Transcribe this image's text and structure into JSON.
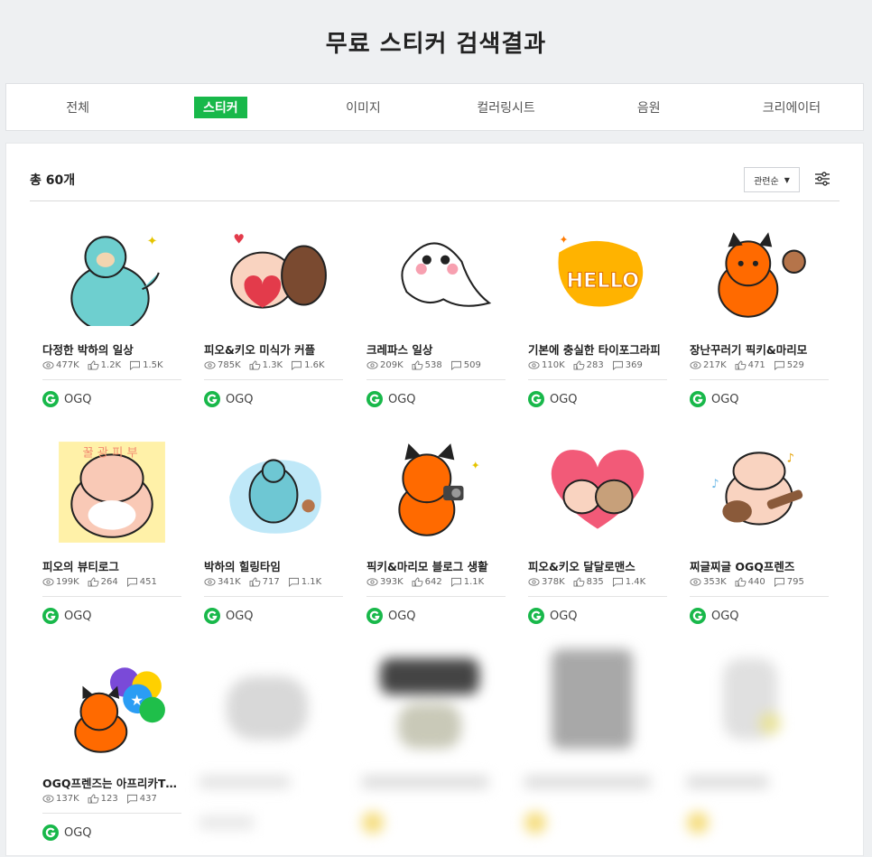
{
  "page": {
    "title": "무료 스티커 검색결과"
  },
  "tabs": [
    {
      "label": "전체",
      "active": false
    },
    {
      "label": "스티커",
      "active": true
    },
    {
      "label": "이미지",
      "active": false
    },
    {
      "label": "컬러링시트",
      "active": false
    },
    {
      "label": "음원",
      "active": false
    },
    {
      "label": "크리에이터",
      "active": false
    }
  ],
  "results": {
    "total_label": "총 60개",
    "sort_label": "관련순"
  },
  "accent_color": "#18b84a",
  "cards": [
    {
      "title": "다정한 박하의 일상",
      "views": "477K",
      "likes": "1.2K",
      "comments": "1.5K",
      "author": "OGQ"
    },
    {
      "title": "피오&키오 미식가 커플",
      "views": "785K",
      "likes": "1.3K",
      "comments": "1.6K",
      "author": "OGQ"
    },
    {
      "title": "크레파스 일상",
      "views": "209K",
      "likes": "538",
      "comments": "509",
      "author": "OGQ"
    },
    {
      "title": "기본에 충실한 타이포그라피",
      "views": "110K",
      "likes": "283",
      "comments": "369",
      "author": "OGQ"
    },
    {
      "title": "장난꾸러기 픽키&마리모",
      "views": "217K",
      "likes": "471",
      "comments": "529",
      "author": "OGQ"
    },
    {
      "title": "피오의 뷰티로그",
      "views": "199K",
      "likes": "264",
      "comments": "451",
      "author": "OGQ"
    },
    {
      "title": "박하의 힐링타임",
      "views": "341K",
      "likes": "717",
      "comments": "1.1K",
      "author": "OGQ"
    },
    {
      "title": "픽키&마리모 블로그 생활",
      "views": "393K",
      "likes": "642",
      "comments": "1.1K",
      "author": "OGQ"
    },
    {
      "title": "피오&키오 달달로맨스",
      "views": "378K",
      "likes": "835",
      "comments": "1.4K",
      "author": "OGQ"
    },
    {
      "title": "찌글찌글 OGQ프렌즈",
      "views": "353K",
      "likes": "440",
      "comments": "795",
      "author": "OGQ"
    },
    {
      "title": "OGQ프렌즈는 아프리카TV에서",
      "views": "137K",
      "likes": "123",
      "comments": "437",
      "author": "OGQ"
    }
  ]
}
